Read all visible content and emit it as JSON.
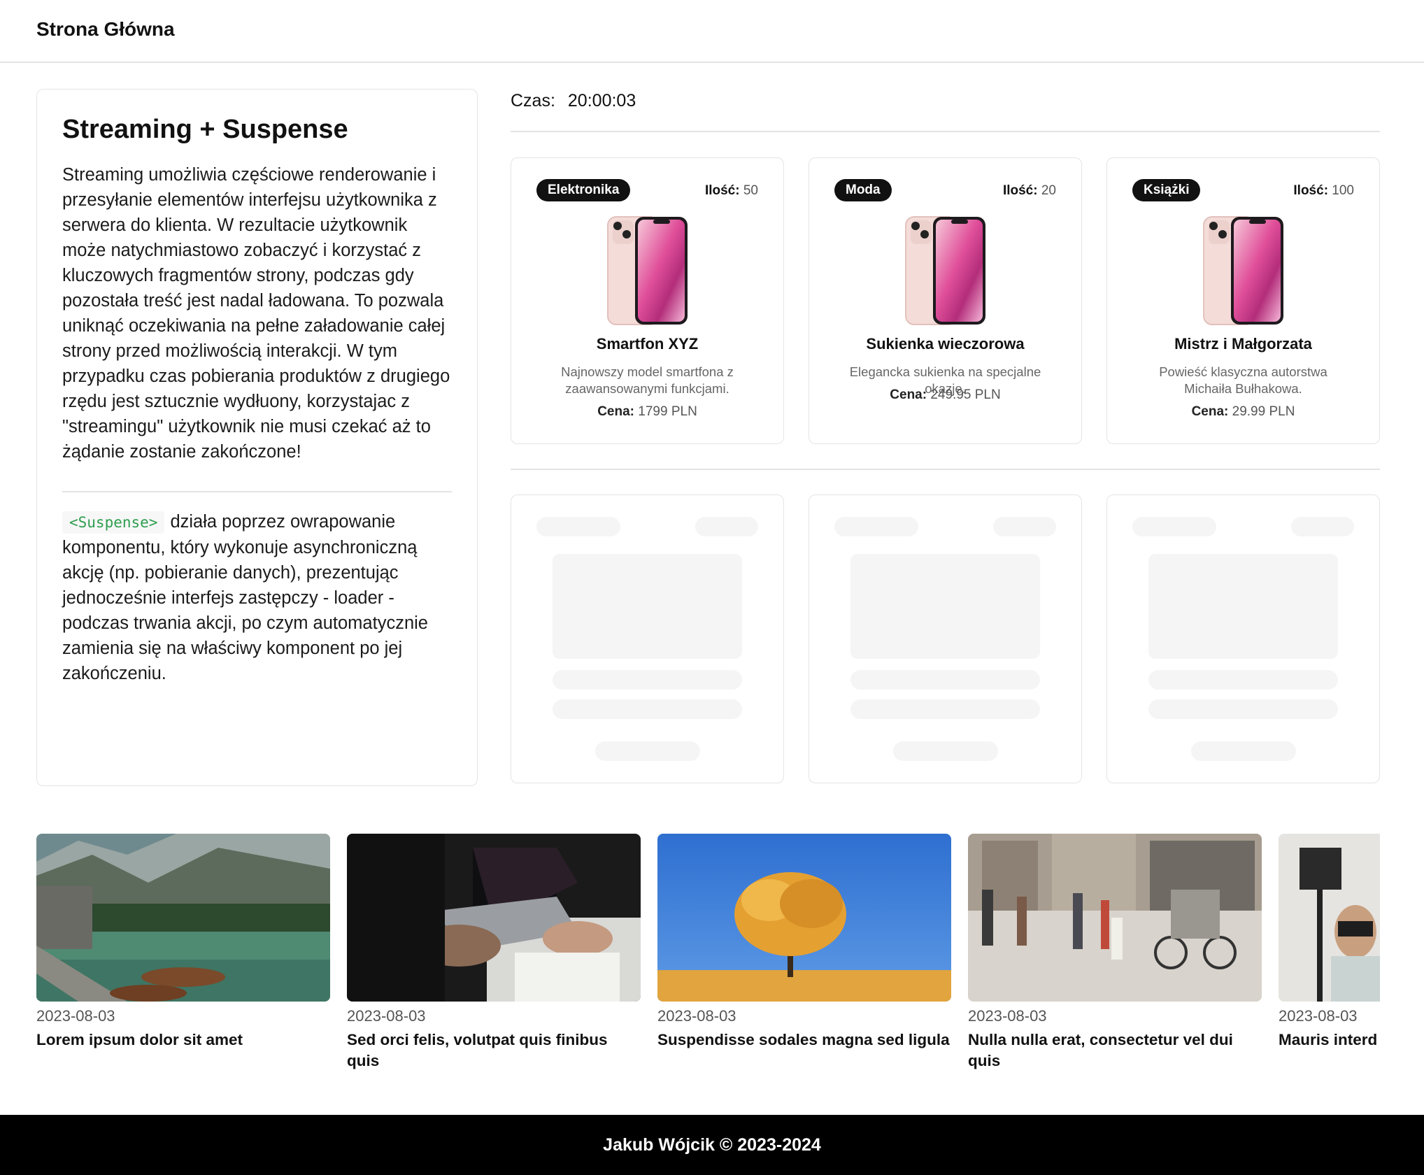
{
  "header": {
    "brand": "Strona Główna"
  },
  "info": {
    "title": "Streaming + Suspense",
    "paragraph1": "Streaming umożliwia częściowe renderowanie i przesyłanie elementów interfejsu użytkownika z serwera do klienta. W rezultacie użytkownik może natychmiastowo zobaczyć i korzystać z kluczowych fragmentów strony, podczas gdy pozostała treść jest nadal ładowana. To pozwala uniknąć oczekiwania na pełne załadowanie całej strony przed możliwością interakcji. W tym przypadku czas pobierania produktów z drugiego rzędu jest sztucznie wydłuony, korzystajac z \"streamingu\" użytkownik nie musi czekać aż to żądanie zostanie zakończone!",
    "code_tag": "<Suspense>",
    "paragraph2": "działa poprzez owrapowanie komponentu, który wykonuje asynchroniczną akcję (np. pobieranie danych), prezentując jednocześnie interfejs zastępczy - loader - podczas trwania akcji, po czym automatycznie zamienia się na właściwy komponent po jej zakończeniu."
  },
  "clock": {
    "label": "Czas:",
    "value": "20:00:03"
  },
  "products": [
    {
      "category": "Elektronika",
      "qty_label": "Ilość:",
      "qty": "50",
      "name": "Smartfon XYZ",
      "description": "Najnowszy model smartfona z zaawansowanymi funkcjami.",
      "price_label": "Cena:",
      "price": "1799 PLN"
    },
    {
      "category": "Moda",
      "qty_label": "Ilość:",
      "qty": "20",
      "name": "Sukienka wieczorowa",
      "description": "Elegancka sukienka na specjalne okazje.",
      "price_label": "Cena:",
      "price": "249.95 PLN"
    },
    {
      "category": "Książki",
      "qty_label": "Ilość:",
      "qty": "100",
      "name": "Mistrz i Małgorzata",
      "description": "Powieść klasyczna autorstwa Michaiła Bułhakowa.",
      "price_label": "Cena:",
      "price": "29.99 PLN"
    }
  ],
  "news": [
    {
      "date": "2023-08-03",
      "title": "Lorem ipsum dolor sit amet",
      "image": "lake-with-boats-photo"
    },
    {
      "date": "2023-08-03",
      "title": "Sed orci felis, volutpat quis finibus quis",
      "image": "people-working-on-laptop-photo"
    },
    {
      "date": "2023-08-03",
      "title": "Suspendisse sodales magna sed ligula",
      "image": "autumn-tree-blue-sky-photo"
    },
    {
      "date": "2023-08-03",
      "title": "Nulla nulla erat, consectetur vel dui quis",
      "image": "city-street-crowd-photo"
    },
    {
      "date": "2023-08-03",
      "title": "Mauris interd maximus ultr",
      "image": "vr-headset-man-photo"
    }
  ],
  "footer": {
    "text": "Jakub Wójcik © 2023-2024"
  },
  "colors": {
    "badge": "#111111",
    "code": "#2e9e4f",
    "skeleton": "#f5f5f5",
    "footer": "#000000"
  }
}
